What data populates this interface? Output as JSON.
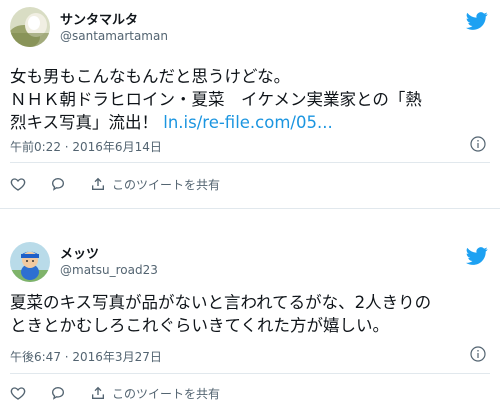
{
  "tweets": [
    {
      "display_name": "サンタマルタ",
      "handle": "@santamartaman",
      "text_line1": "女も男もこんなもんだと思うけどな。",
      "text_line2": "ＮＨＫ朝ドラヒロイン・夏菜　イケメン実業家との「熱",
      "text_line3_prefix": "烈キス写真」流出！ ",
      "link": "ln.is/re-file.com/05...",
      "timestamp": "午前0:22 · 2016年6月14日",
      "share_label": "このツイートを共有"
    },
    {
      "display_name": "メッツ",
      "handle": "@matsu_road23",
      "text_line1": "夏菜のキス写真が品がないと言われてるがな、2人きりの",
      "text_line2": "ときとかむしろこれぐらいきてくれた方が嬉しい。",
      "timestamp": "午後6:47 · 2016年3月27日",
      "share_label": "このツイートを共有"
    }
  ],
  "colors": {
    "accent": "#1da1f2",
    "link": "#1b95e0",
    "muted": "#536471"
  }
}
